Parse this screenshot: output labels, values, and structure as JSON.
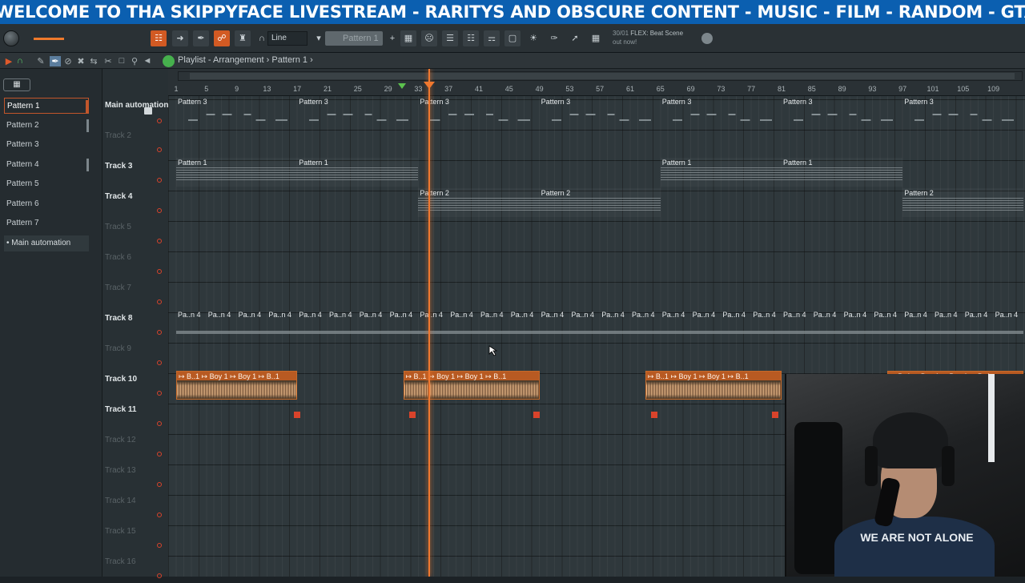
{
  "banner": {
    "text": "WELCOME TO THA SKIPPYFACE LIVESTREAM  - RARITYS AND OBSCURE CONTENT - MUSIC - FILM - RANDOM - GTARP / COD"
  },
  "toolbar": {
    "mode": "Line",
    "pattern": "Pattern 1",
    "news_date": "30/01",
    "news_line1": "FLEX: Beat Scene",
    "news_line2": "out now!"
  },
  "playlist": {
    "title": "Playlist - Arrangement › Pattern 1 ›"
  },
  "patterns": [
    {
      "label": "Pattern 1"
    },
    {
      "label": "Pattern 2"
    },
    {
      "label": "Pattern 3"
    },
    {
      "label": "Pattern 4"
    },
    {
      "label": "Pattern 5"
    },
    {
      "label": "Pattern 6"
    },
    {
      "label": "Pattern 7"
    },
    {
      "label": "• Main automation"
    }
  ],
  "tracks": [
    {
      "name": "Main automation",
      "active": true
    },
    {
      "name": "Track 2",
      "active": false
    },
    {
      "name": "Track 3",
      "active": true
    },
    {
      "name": "Track 4",
      "active": true
    },
    {
      "name": "Track 5",
      "active": false
    },
    {
      "name": "Track 6",
      "active": false
    },
    {
      "name": "Track 7",
      "active": false
    },
    {
      "name": "Track 8",
      "active": true
    },
    {
      "name": "Track 9",
      "active": false
    },
    {
      "name": "Track 10",
      "active": true
    },
    {
      "name": "Track 11",
      "active": true
    },
    {
      "name": "Track 12",
      "active": false
    },
    {
      "name": "Track 13",
      "active": false
    },
    {
      "name": "Track 14",
      "active": false
    },
    {
      "name": "Track 15",
      "active": false
    },
    {
      "name": "Track 16",
      "active": false
    }
  ],
  "ruler": [
    "1",
    "5",
    "9",
    "13",
    "17",
    "21",
    "25",
    "29",
    "33",
    "37",
    "41",
    "45",
    "49",
    "53",
    "57",
    "61",
    "65",
    "69",
    "73",
    "77",
    "81",
    "85",
    "89",
    "93",
    "97",
    "101",
    "105",
    "109"
  ],
  "clip_labels": {
    "p3": "Pattern 3",
    "p1": "Pattern 1",
    "p2": "Pattern 2",
    "p8": "Pa..n 4",
    "audio": "↦ B..1   ↦ Boy 1  ↦ Boy 1  ↦ B..1"
  },
  "webcam": {
    "shirt_text": "WE ARE NOT ALONE"
  },
  "colors": {
    "accent": "#f0782f",
    "banner": "#0b5fb0",
    "audio_clip": "#c56a2a"
  },
  "icons": [
    "knob-icon",
    "piano-roll-icon",
    "arrow-right-icon",
    "link-icon",
    "magnet-icon",
    "stamp-icon",
    "mixer-icon",
    "channel-rack-icon",
    "browser-icon",
    "plugin-icon",
    "globe-icon",
    "play-icon",
    "pencil-icon",
    "brush-icon",
    "delete-icon",
    "mute-icon",
    "slip-icon",
    "select-icon",
    "zoom-icon",
    "playback-icon"
  ]
}
